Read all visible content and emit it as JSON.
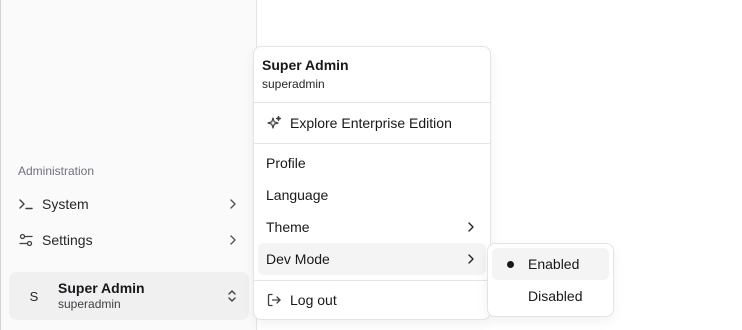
{
  "sidebar": {
    "group_label": "Administration",
    "items": [
      {
        "label": "System",
        "icon": "terminal-icon"
      },
      {
        "label": "Settings",
        "icon": "sliders-icon"
      }
    ],
    "user": {
      "avatar_initial": "S",
      "name": "Super Admin",
      "handle": "superadmin"
    }
  },
  "account_menu": {
    "name": "Super Admin",
    "handle": "superadmin",
    "explore_label": "Explore Enterprise Edition",
    "profile_label": "Profile",
    "language_label": "Language",
    "theme_label": "Theme",
    "dev_mode_label": "Dev Mode",
    "logout_label": "Log out"
  },
  "dev_mode_submenu": {
    "options": [
      {
        "label": "Enabled",
        "selected": true
      },
      {
        "label": "Disabled",
        "selected": false
      }
    ]
  },
  "colors": {
    "sidebar_bg": "#fafafa",
    "hover_bg": "#f4f4f5",
    "text": "#18181b",
    "muted": "#71717a",
    "border": "#e4e4e7"
  }
}
